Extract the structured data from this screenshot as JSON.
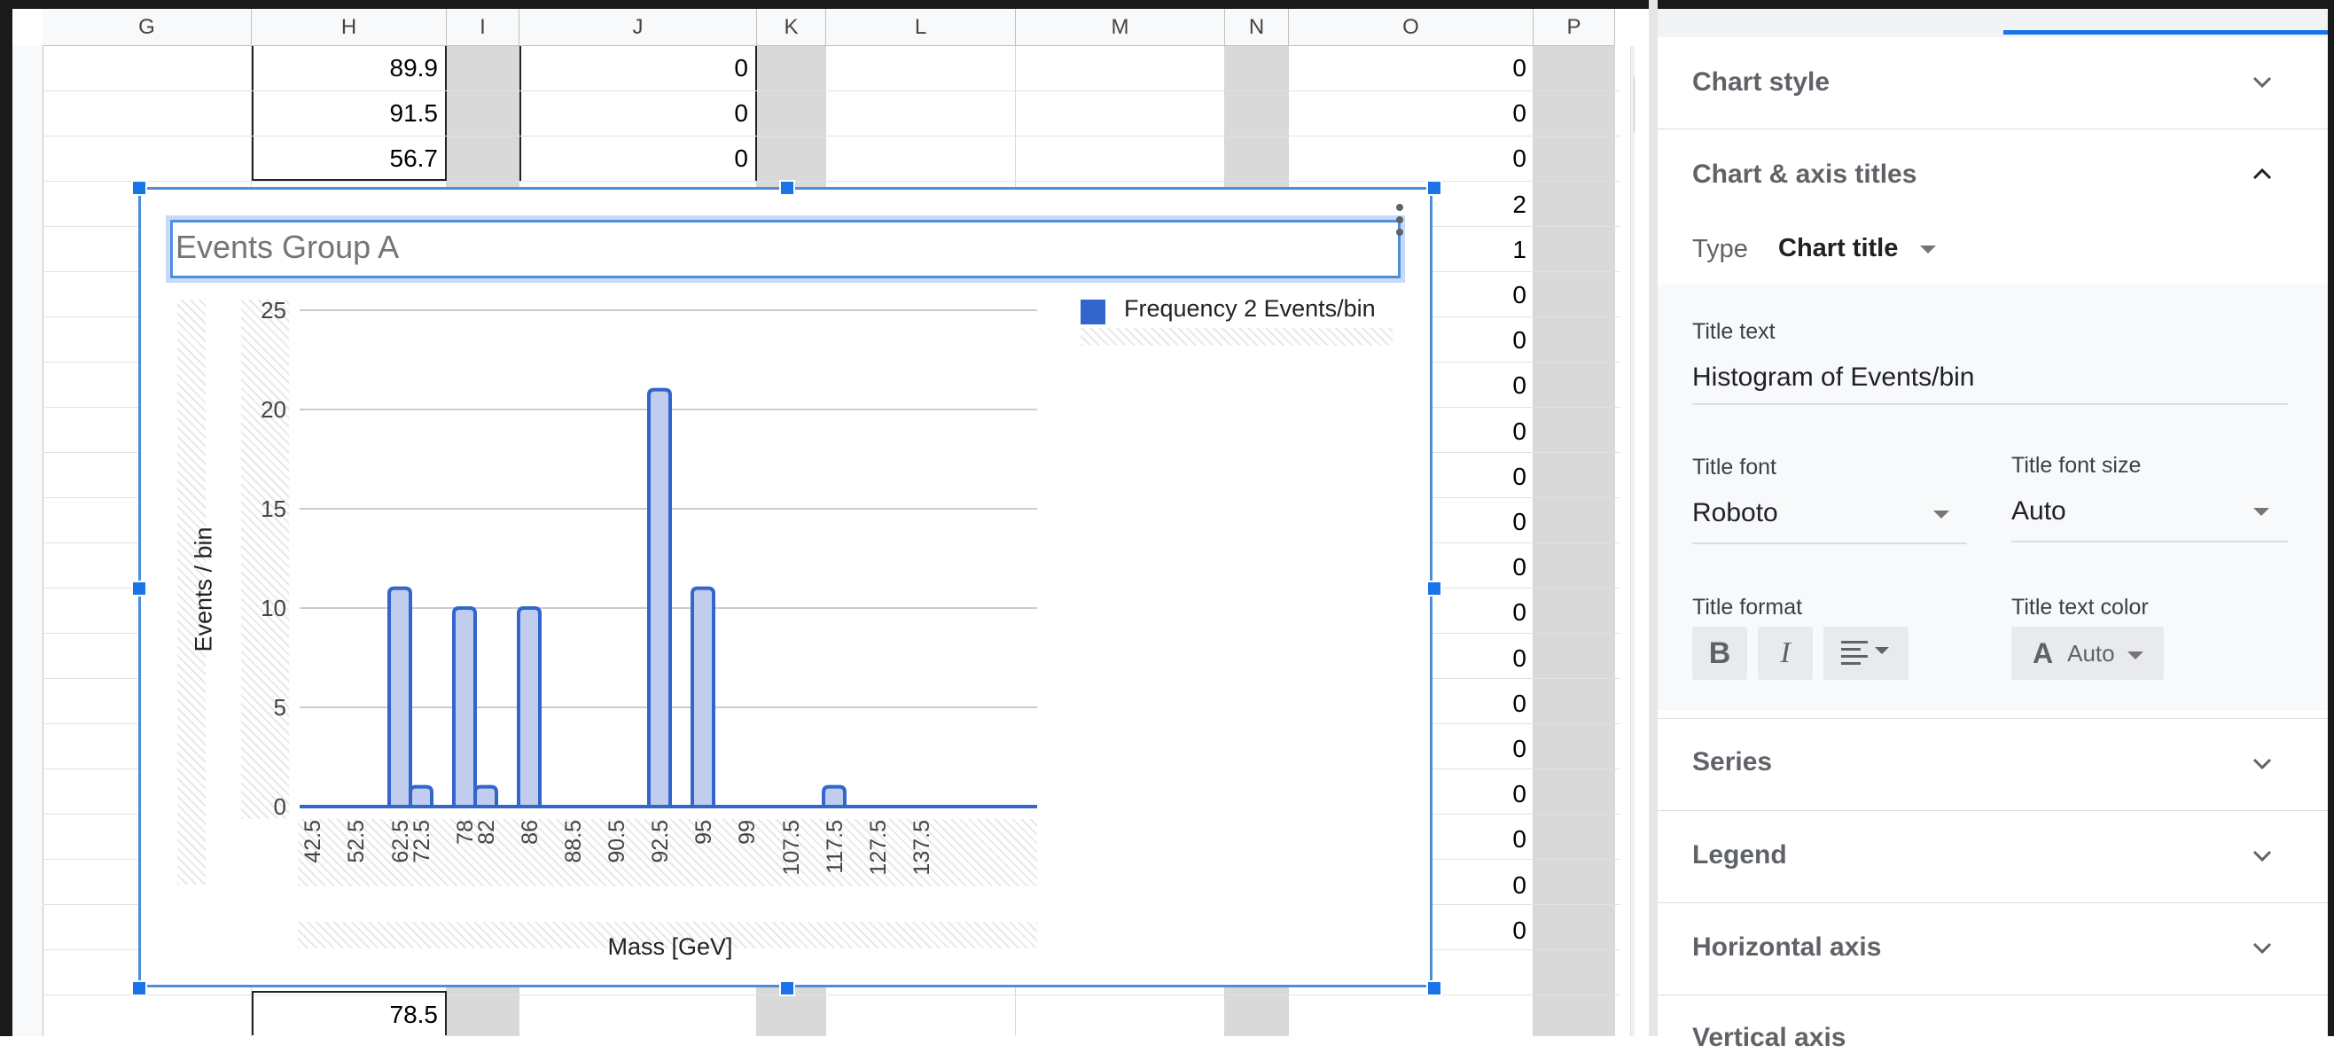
{
  "sheet": {
    "columns": [
      "G",
      "H",
      "I",
      "J",
      "K",
      "L",
      "M",
      "N",
      "O",
      "P"
    ],
    "col_h_values": [
      "89.9",
      "91.5",
      "56.7",
      "78.5"
    ],
    "col_j_values": [
      "0",
      "0",
      "0"
    ],
    "col_o_values": [
      "0",
      "0",
      "0",
      "2",
      "1",
      "0",
      "0",
      "0",
      "0",
      "0",
      "0",
      "0",
      "0",
      "0",
      "0",
      "0",
      "0",
      "0",
      "0",
      "0"
    ]
  },
  "chart": {
    "title": "Events Group A",
    "y_axis_title": "Events / bin",
    "x_axis_title": "Mass [GeV]",
    "legend_label": "Frequency 2 Events/bin"
  },
  "chart_data": {
    "type": "area",
    "title": "Events Group A",
    "xlabel": "Mass [GeV]",
    "ylabel": "Events / bin",
    "ylim": [
      0,
      25
    ],
    "y_ticks": [
      "0",
      "5",
      "10",
      "15",
      "20",
      "25"
    ],
    "x_tick_labels": [
      "42.5",
      "52.5",
      "62.5",
      "72.5",
      "78",
      "82",
      "86",
      "88.5",
      "90.5",
      "92.5",
      "95",
      "99",
      "107.5",
      "117.5",
      "127.5",
      "137.5"
    ],
    "legend_position": "top-right",
    "series": [
      {
        "name": "Frequency 2 Events/bin",
        "color": "#3366cc",
        "x": [
          "42.5",
          "52.5",
          "62.5",
          "72.5",
          "78",
          "82",
          "86",
          "88.5",
          "90.5",
          "92.5",
          "95",
          "99",
          "107.5",
          "117.5",
          "127.5",
          "137.5"
        ],
        "values": [
          0,
          0,
          11,
          1,
          10,
          1,
          10,
          0,
          0,
          21,
          11,
          0,
          0,
          1,
          0,
          0
        ]
      }
    ]
  },
  "panel": {
    "chart_style_label": "Chart style",
    "titles_section_label": "Chart & axis titles",
    "type_label": "Type",
    "type_value": "Chart title",
    "title_text_label": "Title text",
    "title_text_value": "Histogram of Events/bin",
    "title_font_label": "Title font",
    "title_font_value": "Roboto",
    "title_font_size_label": "Title font size",
    "title_font_size_value": "Auto",
    "title_format_label": "Title format",
    "bold_glyph": "B",
    "italic_glyph": "I",
    "title_text_color_label": "Title text color",
    "text_color_glyph": "A",
    "title_text_color_value": "Auto",
    "series_label": "Series",
    "legend_label": "Legend",
    "horizontal_axis_label": "Horizontal axis",
    "vertical_axis_label": "Vertical axis"
  }
}
